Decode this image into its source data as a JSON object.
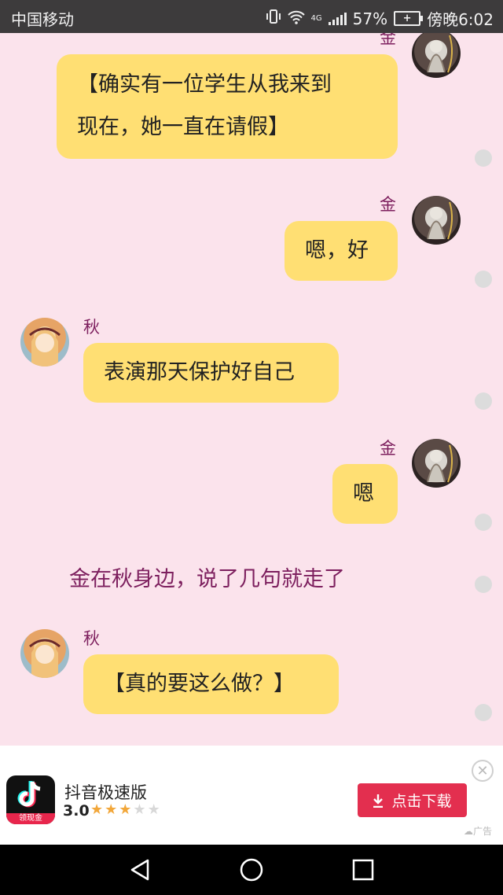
{
  "status_bar": {
    "carrier": "中国移动",
    "network": "4G",
    "battery_percent": "57%",
    "time": "傍晚6:02"
  },
  "chat": {
    "messages": [
      {
        "sender": "金",
        "side": "right",
        "text_lines": [
          "【确实有一位学生从我来到",
          "现在，她一直在请假】"
        ]
      },
      {
        "sender": "金",
        "side": "right",
        "text_lines": [
          "嗯，好"
        ]
      },
      {
        "sender": "秋",
        "side": "left",
        "text_lines": [
          "表演那天保护好自己"
        ]
      },
      {
        "sender": "金",
        "side": "right",
        "text_lines": [
          "嗯"
        ]
      },
      {
        "type": "narration",
        "text": "金在秋身边，说了几句就走了"
      },
      {
        "sender": "秋",
        "side": "left",
        "text_lines": [
          "【真的要这么做？】"
        ]
      }
    ]
  },
  "ad": {
    "app_name": "抖音极速版",
    "icon_tag": "领现金",
    "rating": "3.0",
    "stars_filled": 3,
    "stars_total": 5,
    "download_label": "点击下载",
    "ad_label": "广告",
    "accent_color": "#e32f4f"
  },
  "colors": {
    "background": "#fbe3ec",
    "bubble": "#ffdf73",
    "name_text": "#7d1f5e"
  }
}
